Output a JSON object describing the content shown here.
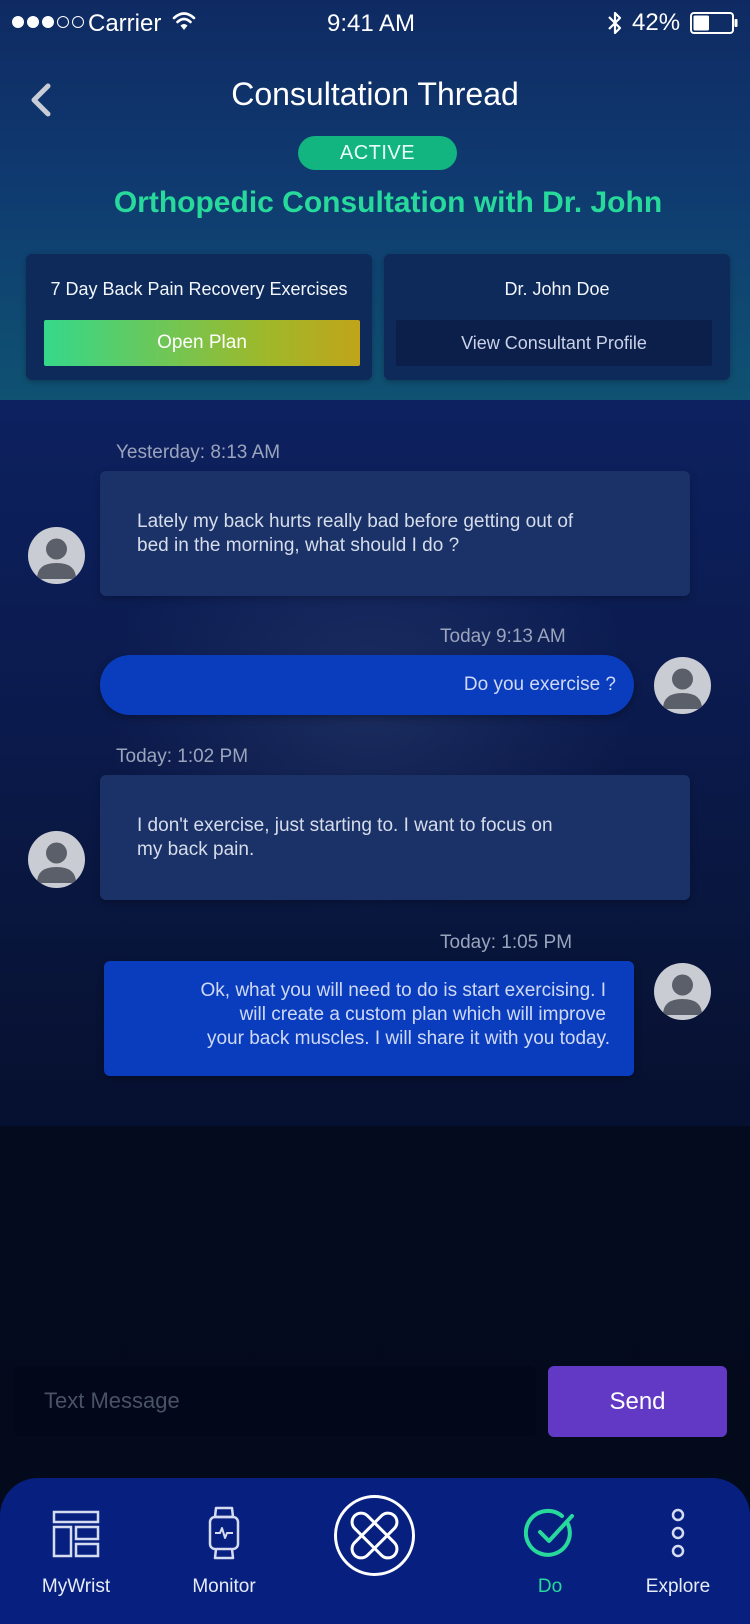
{
  "status_bar": {
    "carrier": "Carrier",
    "time": "9:41 AM",
    "battery_percent": "42%",
    "battery_level": 0.42
  },
  "header": {
    "title": "Consultation Thread",
    "status_badge": "ACTIVE",
    "consultation_title": "Orthopedic Consultation with Dr. John",
    "plan_card": {
      "label": "7 Day Back Pain Recovery Exercises",
      "button": "Open Plan"
    },
    "profile_card": {
      "label": "Dr. John Doe",
      "button": "View Consultant Profile"
    }
  },
  "messages": [
    {
      "direction": "incoming",
      "timestamp": "Yesterday: 8:13 AM",
      "lines": [
        "Lately my back hurts really bad before getting out of",
        "bed in the morning, what should I do ?"
      ]
    },
    {
      "direction": "outgoing",
      "timestamp": "Today 9:13 AM",
      "lines": [
        "Do you exercise ?"
      ]
    },
    {
      "direction": "incoming",
      "timestamp": "Today: 1:02 PM",
      "lines": [
        "I don't exercise, just starting to. I want to focus on",
        "my back pain."
      ]
    },
    {
      "direction": "outgoing",
      "timestamp": "Today: 1:05 PM",
      "lines": [
        "Ok, what you will need to do is start exercising.  I",
        "will create a custom plan which will improve",
        "your back muscles. I will share it with you today."
      ]
    }
  ],
  "composer": {
    "placeholder": "Text Message",
    "send_label": "Send"
  },
  "tab_bar": {
    "items": [
      {
        "label": "MyWrist",
        "icon": "dashboard-icon",
        "active": false
      },
      {
        "label": "Monitor",
        "icon": "smartwatch-icon",
        "active": false
      },
      {
        "label": "",
        "icon": "bandage-logo-icon",
        "active": false
      },
      {
        "label": "Do",
        "icon": "check-circle-icon",
        "active": true
      },
      {
        "label": "Explore",
        "icon": "more-vertical-icon",
        "active": false
      }
    ]
  },
  "colors": {
    "accent_green": "#27d99a",
    "badge_green": "#12b47f",
    "send_purple": "#6139c4",
    "outgoing_bubble": "#0a3dbe",
    "incoming_bubble": "#1a3268",
    "tab_bar": "#072080"
  }
}
